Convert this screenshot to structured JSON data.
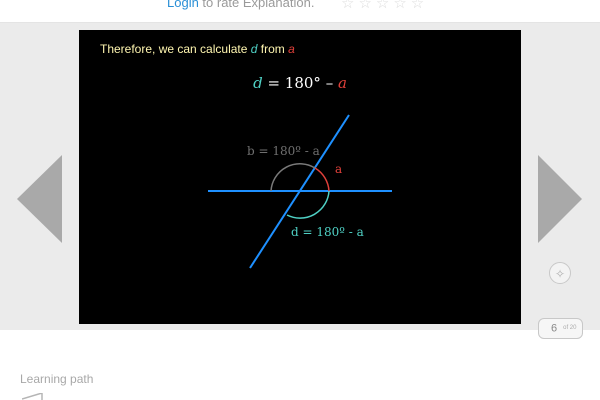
{
  "header": {
    "login_link": "Login",
    "rate_text": " to rate Explanation.",
    "stars": "☆☆☆☆☆"
  },
  "slide": {
    "caption": {
      "prefix": "Therefore, we can calculate ",
      "d": "d",
      "mid": " from ",
      "a": "a"
    },
    "formula": {
      "d": "d",
      "rest": " = 180° – ",
      "a": "a"
    },
    "labels": {
      "b": "b = 180º - a",
      "a": "a",
      "d": "d = 180º - a"
    },
    "colors": {
      "d": "#4fd1c5",
      "a": "#e0403a",
      "line": "#1e90ff",
      "b_arc": "#7a7a7a",
      "caption_text": "#fff6b0"
    }
  },
  "pager": {
    "current": "6",
    "of": "of 20"
  },
  "footer": {
    "learning_path": "Learning path"
  }
}
